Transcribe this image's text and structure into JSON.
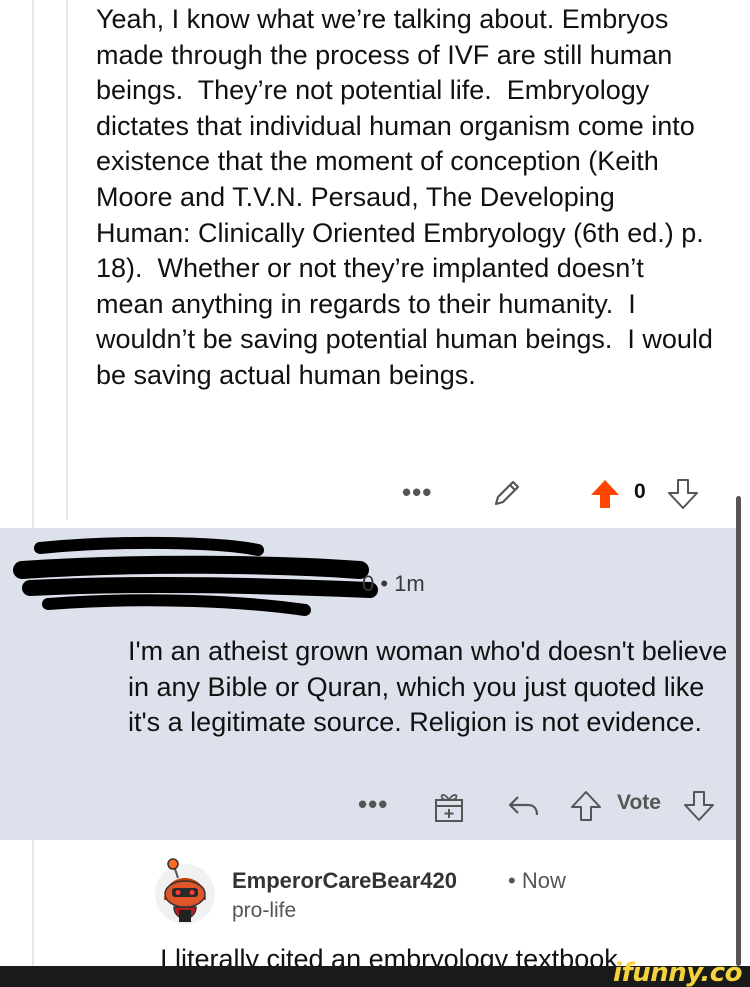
{
  "comment_1": {
    "text": "Yeah, I know what we’re talking about. Embryos made through the process of IVF are still human beings.  They’re not potential life.  Embryology dictates that individual human organism come into existence that the moment of conception (Keith Moore and T.V.N. Persaud, The Developing Human: Clinically Oriented Embryology (6th ed.) p. 18).  Whether or not they’re implanted doesn’t mean anything in regards to their humanity.  I wouldn’t be saving potential human beings.  I would be saving actual human beings.",
    "actions": {
      "more": "•••",
      "edit_icon": "pencil-icon",
      "upvote_icon": "upvote-filled-icon",
      "score": "0",
      "downvote_icon": "downvote-icon"
    }
  },
  "comment_2": {
    "meta_suffix": "0 • 1m",
    "text": "I'm an atheist grown woman who'd doesn't believe in any Bible or Quran, which you just quoted like it's a legitimate source. Religion is not evidence.",
    "actions": {
      "more": "•••",
      "award_icon": "award-icon",
      "reply_icon": "reply-icon",
      "upvote_icon": "upvote-icon",
      "vote_label": "Vote",
      "downvote_icon": "downvote-icon"
    }
  },
  "comment_3": {
    "username": "EmperorCareBear420",
    "meta": "• Now",
    "flair": "pro-life",
    "text": "I literally cited an embryology textbook"
  },
  "watermark": {
    "text": "ifunny.co"
  },
  "colors": {
    "upvote_active": "#ff4500",
    "highlight_bg": "#dde1ec",
    "thread_line": "#e4e6e9",
    "watermark": "#f5d33d"
  }
}
